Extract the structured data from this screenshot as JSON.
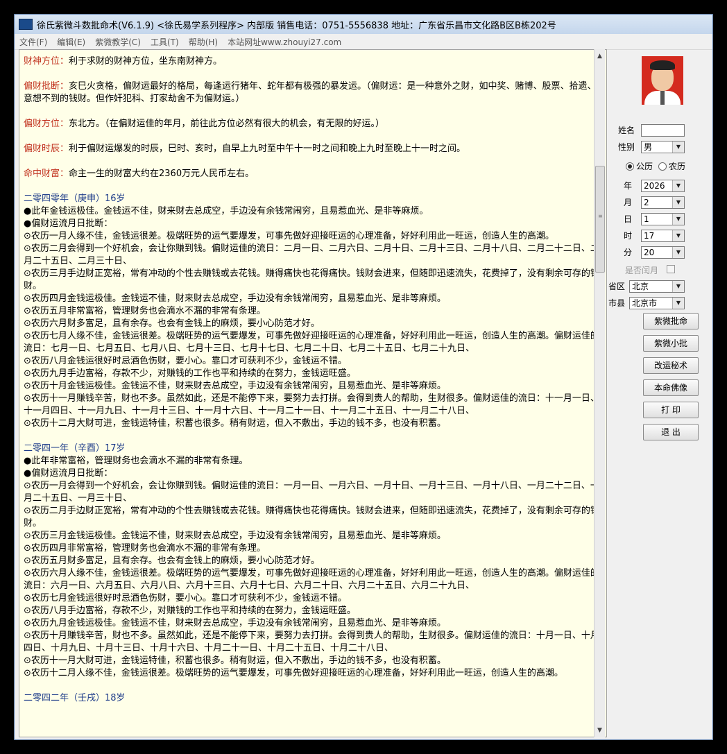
{
  "window": {
    "title": "徐氏紫微斗数批命术(V6.1.9) <徐氏易学系列程序> 内部版 销售电话：0751-5556838 地址：广东省乐昌市文化路B区B栋202号"
  },
  "menu": [
    "文件(F)",
    "编辑(E)",
    "紫微教学(C)",
    "工具(T)",
    "帮助(H)",
    "本站网址www.zhouyi27.com"
  ],
  "content": {
    "top": [
      {
        "label": "财神方位：",
        "text": "利于求财的财神方位，坐东南财神方。"
      },
      {
        "label": "偏财批断：",
        "text": "亥巳火贪格，偏财运最好的格局，每逢运行猪年、蛇年都有极强的暴发运。（偏财运：是一种意外之财，如中奖、赌博、股票、拾遗、意想不到的钱财。但作奸犯科、打家劫舍不为偏财运。）"
      },
      {
        "label": "偏财方位：",
        "text": "东北方。（在偏财运佳的年月，前往此方位必然有很大的机会，有无限的好运。）"
      },
      {
        "label": "偏财时辰：",
        "text": "利于偏财运爆发的时辰，巳时、亥时，自早上九时至中午十一时之间和晚上九时至晚上十一时之间。"
      },
      {
        "label": "命中财富：",
        "text": "命主一生的财富大约在2360万元人民币左右。"
      }
    ],
    "years": [
      {
        "heading": "二零四零年（庚申）16岁",
        "lines": [
          "●此年金钱运极佳。金钱运不佳，财来财去总成空，手边没有余钱常闹穷，且易惹血光、是非等麻烦。",
          "●偏财运流月日批断：",
          "⊙农历一月人缘不佳，金钱运很差。极端旺势的运气要爆发，可事先做好迎接旺运的心理准备，好好利用此一旺运，创造人生的高潮。",
          "⊙农历二月会得到一个好机会，会让你赚到钱。偏财运佳的流日：二月一日、二月六日、二月十日、二月十三日、二月十八日、二月二十二日、二月二十五日、二月三十日、",
          "⊙农历三月手边财正宽裕，常有冲动的个性去赚钱或去花钱。赚得痛快也花得痛快。钱财会进来，但随即迅速流失，花费掉了，没有剩余可存的钱财。",
          "⊙农历四月金钱运极佳。金钱运不佳，财来财去总成空，手边没有余钱常闹穷，且易惹血光、是非等麻烦。",
          "⊙农历五月非常富裕，管理财务也会滴水不漏的非常有条理。",
          "⊙农历六月财多富足，且有余存。也会有金钱上的麻烦，要小心防范才好。",
          "⊙农历七月人缘不佳，金钱运很差。极端旺势的运气要爆发，可事先做好迎接旺运的心理准备，好好利用此一旺运，创造人生的高潮。偏财运佳的流日：七月一日、七月五日、七月八日、七月十三日、七月十七日、七月二十日、七月二十五日、七月二十九日、",
          "⊙农历八月金钱运很好时忌酒色伤财，要小心。靠口才可获利不少，金钱运不错。",
          "⊙农历九月手边富裕，存款不少，对赚钱的工作也平和持续的在努力，金钱运旺盛。",
          "⊙农历十月金钱运极佳。金钱运不佳，财来财去总成空，手边没有余钱常闹穷，且易惹血光、是非等麻烦。",
          "⊙农历十一月赚钱辛苦，财也不多。虽然如此，还是不能停下来，要努力去打拼。会得到贵人的帮助，生财很多。偏财运佳的流日：十一月一日、十一月四日、十一月九日、十一月十三日、十一月十六日、十一月二十一日、十一月二十五日、十一月二十八日、",
          "⊙农历十二月大财可进，金钱运特佳，积蓄也很多。稍有财运，但入不敷出，手边的钱不多，也没有积蓄。"
        ]
      },
      {
        "heading": "二零四一年（辛酉）17岁",
        "lines": [
          "●此年非常富裕，管理财务也会滴水不漏的非常有条理。",
          "●偏财运流月日批断：",
          "⊙农历一月会得到一个好机会，会让你赚到钱。偏财运佳的流日：一月一日、一月六日、一月十日、一月十三日、一月十八日、一月二十二日、一月二十五日、一月三十日、",
          "⊙农历二月手边财正宽裕，常有冲动的个性去赚钱或去花钱。赚得痛快也花得痛快。钱财会进来，但随即迅速流失，花费掉了，没有剩余可存的钱财。",
          "⊙农历三月金钱运极佳。金钱运不佳，财来财去总成空，手边没有余钱常闹穷，且易惹血光、是非等麻烦。",
          "⊙农历四月非常富裕，管理财务也会滴水不漏的非常有条理。",
          "⊙农历五月财多富足，且有余存。也会有金钱上的麻烦，要小心防范才好。",
          "⊙农历六月人缘不佳，金钱运很差。极端旺势的运气要爆发，可事先做好迎接旺运的心理准备，好好利用此一旺运，创造人生的高潮。偏财运佳的流日：六月一日、六月五日、六月八日、六月十三日、六月十七日、六月二十日、六月二十五日、六月二十九日、",
          "⊙农历七月金钱运很好时忌酒色伤财，要小心。靠口才可获利不少，金钱运不错。",
          "⊙农历八月手边富裕，存款不少，对赚钱的工作也平和持续的在努力，金钱运旺盛。",
          "⊙农历九月金钱运极佳。金钱运不佳，财来财去总成空，手边没有余钱常闹穷，且易惹血光、是非等麻烦。",
          "⊙农历十月赚钱辛苦，财也不多。虽然如此，还是不能停下来，要努力去打拼。会得到贵人的帮助，生财很多。偏财运佳的流日：十月一日、十月四日、十月九日、十月十三日、十月十六日、十月二十一日、十月二十五日、十月二十八日、",
          "⊙农历十一月大财可进，金钱运特佳，积蓄也很多。稍有财运，但入不敷出，手边的钱不多，也没有积蓄。",
          "⊙农历十二月人缘不佳，金钱运很差。极端旺势的运气要爆发，可事先做好迎接旺运的心理准备，好好利用此一旺运，创造人生的高潮。"
        ]
      },
      {
        "heading": "二零四二年（壬戌）18岁",
        "lines": []
      }
    ]
  },
  "panel": {
    "name_label": "姓名",
    "gender_label": "性别",
    "gender_value": "男",
    "calendar_solar": "公历",
    "calendar_lunar": "农历",
    "year_label": "年",
    "year_value": "2026",
    "month_label": "月",
    "month_value": "2",
    "day_label": "日",
    "day_value": "1",
    "hour_label": "时",
    "hour_value": "17",
    "minute_label": "分",
    "minute_value": "20",
    "leap_label": "是否闰月",
    "province_label": "省区",
    "province_value": "北京",
    "city_label": "市县",
    "city_value": "北京市",
    "buttons": [
      "紫微批命",
      "紫微小批",
      "改运秘术",
      "本命佛像",
      "打 印",
      "退 出"
    ]
  }
}
